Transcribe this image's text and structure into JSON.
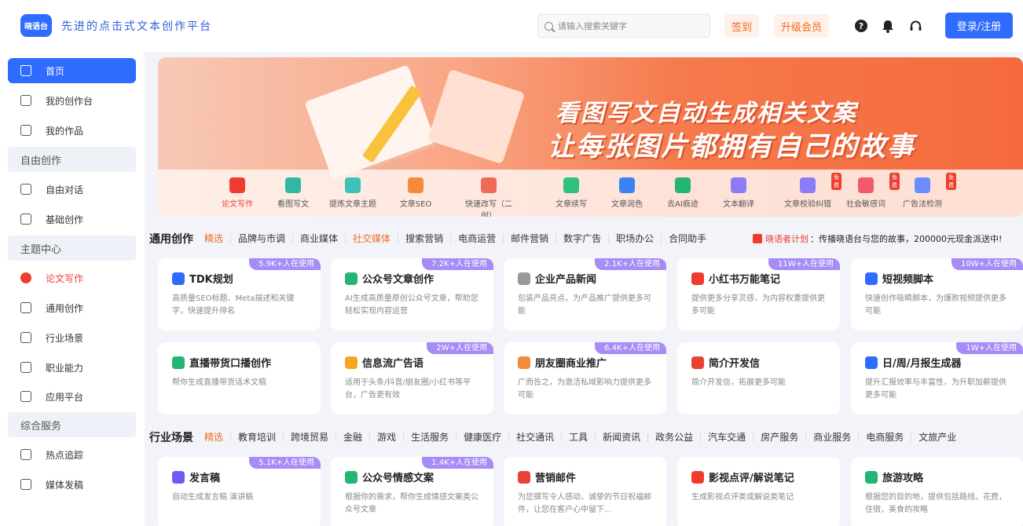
{
  "header": {
    "logo": "晓语台",
    "slogan": "先进的点击式文本创作平台",
    "search_placeholder": "请输入搜索关键字",
    "checkin": "签到",
    "upgrade": "升级会员",
    "login": "登录/注册"
  },
  "sidebar": {
    "items": [
      {
        "label": "首页",
        "icon": "home-icon"
      },
      {
        "label": "我的创作台",
        "icon": "workbench-icon"
      },
      {
        "label": "我的作品",
        "icon": "works-icon"
      }
    ],
    "group1": "自由创作",
    "items2": [
      {
        "label": "自由对话",
        "icon": "chat-icon"
      },
      {
        "label": "基础创作",
        "icon": "edit-icon"
      }
    ],
    "group2": "主题中心",
    "items3": [
      {
        "label": "论文写作",
        "icon": "paper-icon"
      },
      {
        "label": "通用创作",
        "icon": "layers-icon"
      },
      {
        "label": "行业场景",
        "icon": "scene-icon"
      },
      {
        "label": "职业能力",
        "icon": "career-icon"
      },
      {
        "label": "应用平台",
        "icon": "app-icon"
      }
    ],
    "group3": "综合服务",
    "items4": [
      {
        "label": "热点追踪",
        "icon": "trend-icon"
      },
      {
        "label": "媒体发稿",
        "icon": "media-icon"
      }
    ]
  },
  "banner": {
    "line1": "看图写文自动生成相关文案",
    "line2": "让每张图片都拥有自己的故事",
    "tools": [
      {
        "label": "论文写作",
        "color": "#f03c2e",
        "free": ""
      },
      {
        "label": "看图写文",
        "color": "#2fb9a5",
        "free": ""
      },
      {
        "label": "提炼文章主题",
        "color": "#3dc2b5",
        "free": ""
      },
      {
        "label": "文章SEO",
        "color": "#f58a3c",
        "free": ""
      },
      {
        "label": "快速改写（二创）",
        "color": "#f06a5a",
        "free": ""
      },
      {
        "label": "文章续写",
        "color": "#2fc27a",
        "free": ""
      },
      {
        "label": "文章润色",
        "color": "#3b82f6",
        "free": ""
      },
      {
        "label": "去AI痕迹",
        "color": "#22b573",
        "free": ""
      },
      {
        "label": "文本翻译",
        "color": "#8b7cf6",
        "free": ""
      },
      {
        "label": "文章校验纠错",
        "color": "#8b7cf6",
        "free": "免费"
      },
      {
        "label": "社会敏感词",
        "color": "#f05a6a",
        "free": "免费"
      },
      {
        "label": "广告法检测",
        "color": "#6b8cff",
        "free": "免费"
      }
    ]
  },
  "general": {
    "title": "通用创作",
    "tabs": [
      "精选",
      "品牌与市调",
      "商业媒体",
      "社交媒体",
      "搜索营销",
      "电商运营",
      "邮件营销",
      "数字广告",
      "职场办公",
      "合同助手"
    ],
    "promo_label": "晓语者计划",
    "promo_text": "：传播晓语台与您的故事，200000元现金派送中!",
    "cards": [
      {
        "title": "TDK规划",
        "badge": "5.9K+人在使用",
        "desc": "高质量SEO标题、Meta描述和关键字，快速提升排名",
        "color": "#2f6bff"
      },
      {
        "title": "公众号文章创作",
        "badge": "7.2K+人在使用",
        "desc": "AI生成高质量原创公众号文章，帮助您轻松实现内容运营",
        "color": "#22b573"
      },
      {
        "title": "企业产品新闻",
        "badge": "2.1K+人在使用",
        "desc": "包装产品亮点，为产品推广提供更多可能",
        "color": "#999999"
      },
      {
        "title": "小红书万能笔记",
        "badge": "11W+人在使用",
        "desc": "提供更多分享灵感，为内容权重提供更多可能",
        "color": "#f03c2e"
      },
      {
        "title": "短视频脚本",
        "badge": "10W+人在使用",
        "desc": "快速创作吸睛脚本，为爆款视频提供更多可能",
        "color": "#2f6bff"
      },
      {
        "title": "直播带货口播创作",
        "badge": "",
        "desc": "帮你生成直播带货话术文稿",
        "color": "#22b573"
      },
      {
        "title": "信息流广告语",
        "badge": "2W+人在使用",
        "desc": "适用于头条/抖音/朋友圈/小红书等平台，广告更有效",
        "color": "#f5a623"
      },
      {
        "title": "朋友圈商业推广",
        "badge": "6.4K+人在使用",
        "desc": "广而告之，为激活私域影响力提供更多可能",
        "color": "#f58a3c"
      },
      {
        "title": "简介开发信",
        "badge": "",
        "desc": "简介开发信，拓展更多可能",
        "color": "#e94235"
      },
      {
        "title": "日/周/月报生成器",
        "badge": "1W+人在使用",
        "desc": "提升汇报效率与丰富性，为升职加薪提供更多可能",
        "color": "#2f6bff"
      }
    ]
  },
  "industry": {
    "title": "行业场景",
    "tabs": [
      "精选",
      "教育培训",
      "跨境贸易",
      "金融",
      "游戏",
      "生活服务",
      "健康医疗",
      "社交通讯",
      "工具",
      "新闻资讯",
      "政务公益",
      "汽车交通",
      "房产服务",
      "商业服务",
      "电商服务",
      "文旅产业"
    ],
    "cards": [
      {
        "title": "发言稿",
        "badge": "5.1K+人在使用",
        "desc": "自动生成发言稿 演讲稿",
        "color": "#6b5cf6"
      },
      {
        "title": "公众号情感文案",
        "badge": "1.4K+人在使用",
        "desc": "根据你的需求，帮你生成情感文案类公众号文章",
        "color": "#22b573"
      },
      {
        "title": "营销邮件",
        "badge": "",
        "desc": "为您撰写令人感动、诚挚的节日祝福邮件，让您在客户心中留下...",
        "color": "#e94235"
      },
      {
        "title": "影视点评/解说笔记",
        "badge": "",
        "desc": "生成影视点评类或解说类笔记",
        "color": "#f03c2e"
      },
      {
        "title": "旅游攻略",
        "badge": "",
        "desc": "根据您的目的地，提供包括路线、花费，住宿，美食的攻略",
        "color": "#22b573"
      }
    ]
  }
}
